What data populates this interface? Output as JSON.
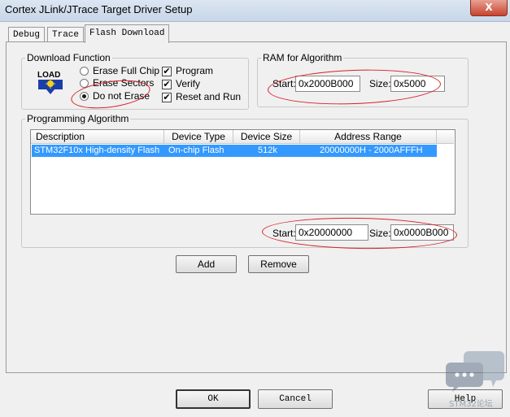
{
  "window": {
    "title": "Cortex JLink/JTrace Target Driver Setup",
    "close_glyph": "X"
  },
  "tabs": [
    {
      "label": "Debug",
      "active": false
    },
    {
      "label": "Trace",
      "active": false
    },
    {
      "label": "Flash Download",
      "active": true
    }
  ],
  "download_function": {
    "title": "Download Function",
    "icon": "load-icon",
    "icon_text": "LOAD",
    "radios": [
      {
        "label": "Erase Full Chip",
        "checked": false
      },
      {
        "label": "Erase Sectors",
        "checked": false
      },
      {
        "label": "Do not Erase",
        "checked": true
      }
    ],
    "checks": [
      {
        "label": "Program",
        "checked": true
      },
      {
        "label": "Verify",
        "checked": true
      },
      {
        "label": "Reset and Run",
        "checked": true
      }
    ],
    "check_glyph": "✔"
  },
  "ram_for_algorithm": {
    "title": "RAM for Algorithm",
    "start_label": "Start:",
    "start_value": "0x2000B000",
    "size_label": "Size:",
    "size_value": "0x5000"
  },
  "programming_algorithm": {
    "title": "Programming Algorithm",
    "columns": [
      "Description",
      "Device Type",
      "Device Size",
      "Address Range"
    ],
    "rows": [
      {
        "description": "STM32F10x High-density Flash",
        "device_type": "On-chip Flash",
        "device_size": "512k",
        "address_range": "20000000H - 2000AFFFH",
        "selected": true
      }
    ],
    "start_label": "Start:",
    "start_value": "0x20000000",
    "size_label": "Size:",
    "size_value": "0x0000B000"
  },
  "buttons": {
    "add": "Add",
    "remove": "Remove",
    "ok": "OK",
    "cancel": "Cancel",
    "help": "Help"
  },
  "watermark": {
    "icon": "chat-bubble-icon",
    "text": "STM32论坛"
  },
  "colors": {
    "selection": "#3399ff",
    "annotation": "#d8202a",
    "window_frame": "#c7d6e8"
  }
}
